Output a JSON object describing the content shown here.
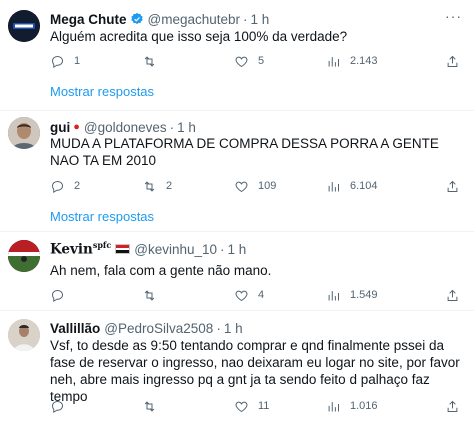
{
  "colors": {
    "link": "#1d9bf0",
    "muted": "#536471",
    "verified": "#1d9bf0"
  },
  "tweets": [
    {
      "name": "Mega Chute",
      "verified": true,
      "handle": "@megachutebr",
      "dot": "·",
      "time": "1 h",
      "text": "Alguém acredita que isso seja 100% da verdade?",
      "replies": "1",
      "retweets": "",
      "likes": "5",
      "views": "2.143",
      "show_replies": "Mostrar respostas"
    },
    {
      "name": "gui",
      "emoji": "🍎",
      "handle": "@goldoneves",
      "dot": "·",
      "time": "1 h",
      "text": "MUDA A PLATAFORMA DE COMPRA DESSA PORRA A GENTE NAO TA EM 2010",
      "replies": "2",
      "retweets": "2",
      "likes": "109",
      "views": "6.104",
      "show_replies": "Mostrar respostas"
    },
    {
      "name": "Kevin",
      "name_sup": "spfc",
      "handle": "@kevinhu_10",
      "dot": "·",
      "time": "1 h",
      "text": "Ah nem, fala com a gente não mano.",
      "replies": "",
      "retweets": "",
      "likes": "4",
      "views": "1.549"
    },
    {
      "name": "Vallillão",
      "handle": "@PedroSilva2508",
      "dot": "·",
      "time": "1 h",
      "text": "Vsf, to desde as 9:50 tentando comprar e qnd finalmente pssei da fase de reservar o ingresso, nao deixaram eu logar no site, por favor neh, abre mais ingresso pq a gnt ja ta sendo feito d palhaço faz tempo",
      "replies": "",
      "retweets": "",
      "likes": "11",
      "views": "1.016"
    }
  ],
  "more_icon": "···"
}
